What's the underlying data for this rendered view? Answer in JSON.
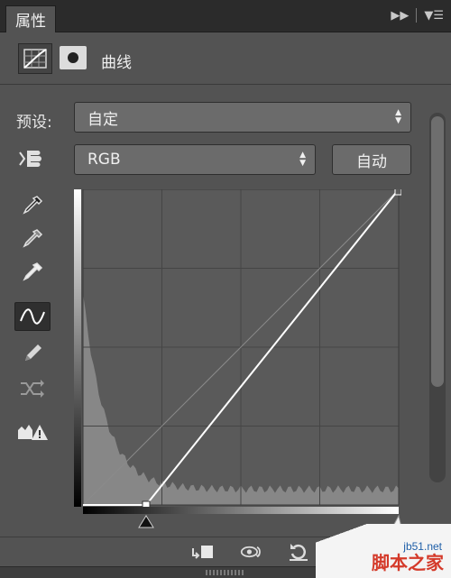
{
  "panel": {
    "tab_label": "属性"
  },
  "header": {
    "title": "曲线",
    "adjustment_icon": "curves-adjustment-icon",
    "mask_icon": "layer-mask-icon"
  },
  "preset": {
    "label": "预设:",
    "value": "自定"
  },
  "channel": {
    "value": "RGB"
  },
  "auto_button": {
    "label": "自动"
  },
  "tools": [
    "target-adjust-hand-icon",
    "black-point-eyedropper-icon",
    "gray-point-eyedropper-icon",
    "white-point-eyedropper-icon",
    "curve-edit-points-icon",
    "pencil-draw-icon",
    "smooth-curve-icon",
    "clipping-warning-icon"
  ],
  "curve": {
    "input_black_point": 0.2,
    "output_black_point": 0.0,
    "input_white_point": 1.0,
    "output_white_point": 1.0
  },
  "colors": {
    "panel_bg": "#535353",
    "graph_bg": "#5a5a5a",
    "histogram": "#8f8f8f",
    "curve": "#ffffff"
  },
  "watermark": {
    "site": "jb51.net",
    "name": "脚本之家"
  }
}
